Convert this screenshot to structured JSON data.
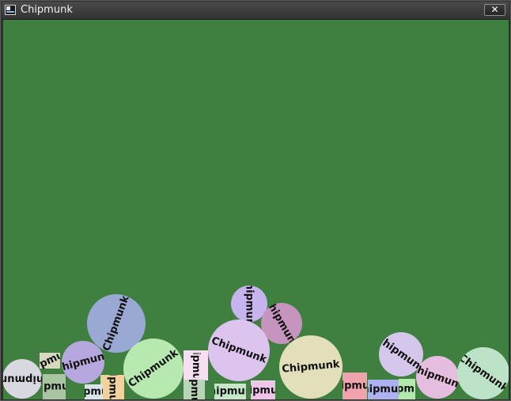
{
  "window": {
    "title": "Chipmunk",
    "close_glyph": "✕",
    "icon": "window-app-icon"
  },
  "scene": {
    "background": "#3f8041",
    "label_text": "Chipmunk",
    "circles": [
      {
        "color": "#9aa8d4",
        "rotation": -70
      },
      {
        "color": "#c7b4ef",
        "rotation": 90
      },
      {
        "color": "#c595c0",
        "rotation": 60
      },
      {
        "color": "#b7a7df",
        "rotation": -15
      },
      {
        "color": "#b6e8b0",
        "rotation": -35
      },
      {
        "color": "#dcc4ef",
        "rotation": 20
      },
      {
        "color": "#e4dfbb",
        "rotation": -5
      },
      {
        "color": "#d5c7ec",
        "rotation": 35
      },
      {
        "color": "#d8d8e1",
        "rotation": 180
      },
      {
        "color": "#e4bddf",
        "rotation": 20
      },
      {
        "color": "#bce3c7",
        "rotation": 35
      }
    ],
    "boxes": [
      {
        "color": "#d8d8c0",
        "rotation": -25
      },
      {
        "color": "#f5dff0",
        "rotation": 90
      },
      {
        "color": "#efcfef",
        "rotation": 0
      },
      {
        "color": "#b7d6b7",
        "rotation": 90
      },
      {
        "color": "#aac5a1",
        "rotation": 0
      },
      {
        "color": "#f1d29e",
        "rotation": 90
      },
      {
        "color": "#d9e5ea",
        "rotation": 0
      },
      {
        "color": "#c5e7c7",
        "rotation": 0
      },
      {
        "color": "#efc4e8",
        "rotation": 0
      },
      {
        "color": "#f1a3ad",
        "rotation": 0
      },
      {
        "color": "#aeb1ef",
        "rotation": 0
      },
      {
        "color": "#b3e8ae",
        "rotation": 0
      }
    ]
  }
}
